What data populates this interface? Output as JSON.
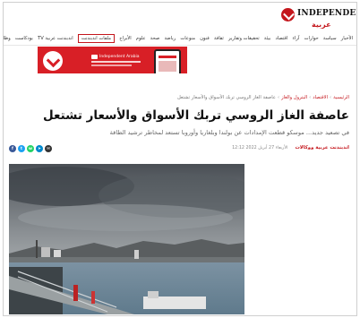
{
  "header": {
    "logo_en": "INDEPENDENT",
    "logo_ar": "عربية"
  },
  "nav": {
    "items": [
      "الأخبار",
      "سياسة",
      "حوارات",
      "آراء",
      "اقتصاد",
      "بيئة",
      "تحقيقات وتقارير",
      "ثقافة",
      "فنون",
      "منوعات",
      "رياضة",
      "صحة",
      "علوم",
      "الأبراج",
      "ملفات اندبندنت",
      "اندبندنت عربية TV",
      "بودكاست",
      "وظائف"
    ],
    "highlighted_index": 14
  },
  "ad": {
    "brand": "Independent Arabia"
  },
  "breadcrumb": {
    "items": [
      "الرئيسية",
      "الاقتصاد",
      "البترول والغاز",
      "عاصفة الغاز الروسي تربك الأسواق والأسعار تشتعل"
    ]
  },
  "article": {
    "title": "عاصفة الغاز الروسي تربك الأسواق والأسعار تشتعل",
    "subtitle": "في تصعيد جديد... موسكو قطعت الإمدادات عن بولندا وبلغاريا وأوروبا تستعد لمخاطر ترشيد الطاقة",
    "author": "اندبندنت عربية ووكالات",
    "date": "الأربعاء 27 أبريل 2022 12:12"
  },
  "share": {
    "icons": [
      {
        "name": "facebook-icon",
        "color": "#3b5998",
        "glyph": "f"
      },
      {
        "name": "twitter-icon",
        "color": "#1da1f2",
        "glyph": "t"
      },
      {
        "name": "whatsapp-icon",
        "color": "#25d366",
        "glyph": "w"
      },
      {
        "name": "telegram-icon",
        "color": "#0088cc",
        "glyph": "➤"
      },
      {
        "name": "email-icon",
        "color": "#333333",
        "glyph": "✉"
      }
    ]
  },
  "colors": {
    "brand_red": "#c4161c"
  }
}
